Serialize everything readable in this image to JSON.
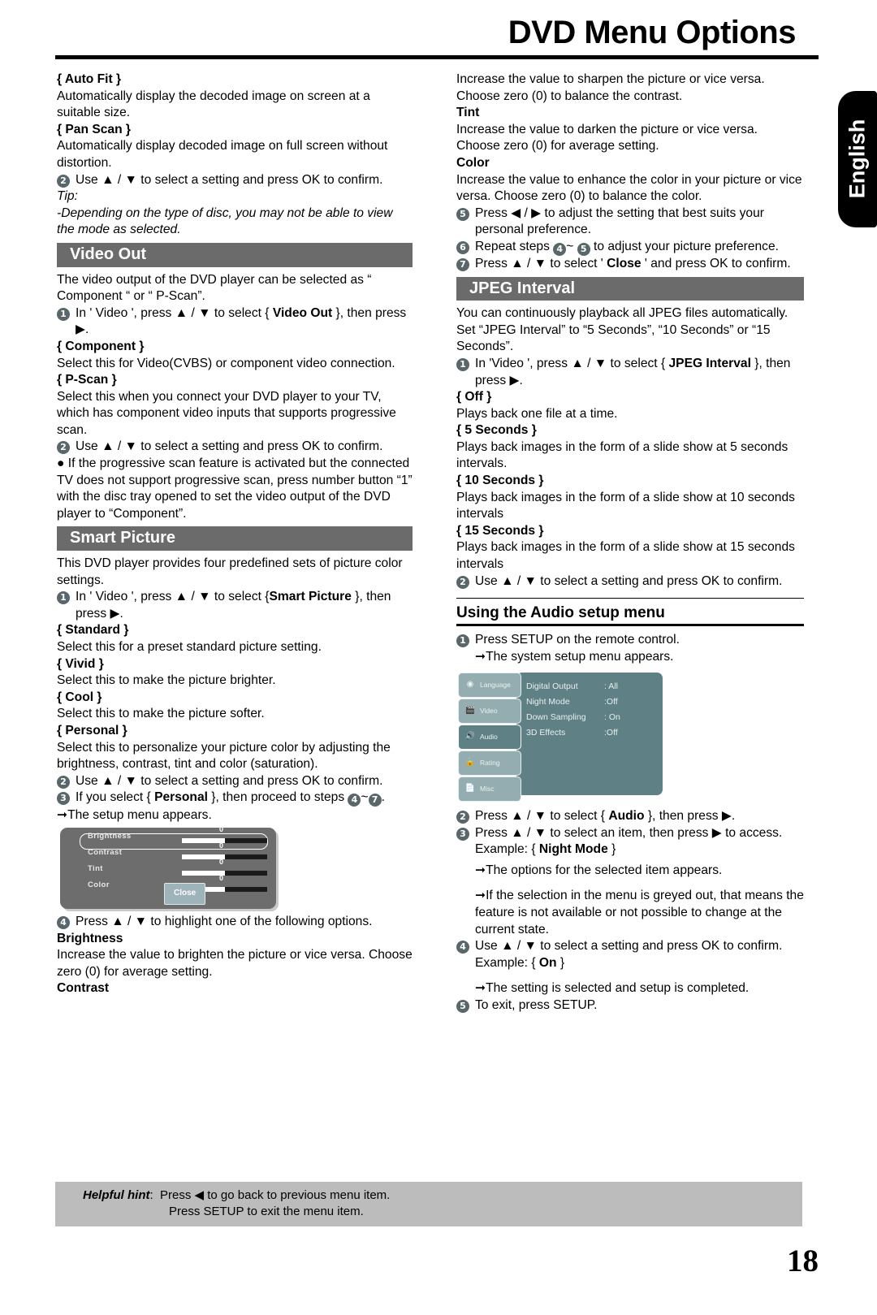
{
  "page": {
    "title": "DVD Menu Options",
    "number": "18",
    "language_tab": "English"
  },
  "left_column": {
    "auto_fit": {
      "heading": "{ Auto Fit }",
      "body": "Automatically display the decoded image on screen at a suitable size."
    },
    "pan_scan": {
      "heading": "{ Pan Scan }",
      "body": "Automatically display decoded image on full screen without distortion."
    },
    "step_select_confirm": {
      "num": "2",
      "text": "Use ▲ / ▼ to select a setting and press OK to confirm."
    },
    "tip": {
      "label": "Tip:",
      "text": "-Depending on the type of disc, you may not be able to view the mode as selected."
    },
    "video_out": {
      "section_title": "Video Out",
      "intro": "The video output of the DVD player can be selected as “ Component “ or “ P-Scan”.",
      "step1": {
        "num": "1",
        "text_a": "In ʹ Video ʹ, press ▲ / ▼   to select  { ",
        "bold": "Video Out",
        "text_b": " }, then press ▶."
      },
      "component": {
        "heading": "{ Component }",
        "body": "Select this for Video(CVBS) or component video connection."
      },
      "pscan": {
        "heading": "{ P-Scan }",
        "body": "Select this when you connect your DVD player to your TV, which has component video inputs that supports progressive scan."
      },
      "step2": {
        "num": "2",
        "text": "Use ▲ / ▼ to select a setting and press OK to confirm."
      },
      "bullet": "● If the progressive scan feature is activated but the connected TV does not support progressive scan, press number button “1” with the disc tray opened to set the video output of the DVD player to “Component”."
    },
    "smart_picture": {
      "section_title": "Smart Picture",
      "intro": "This DVD player provides four predefined sets of picture color settings.",
      "step1": {
        "num": "1",
        "text_a": "In ʹ Video ʹ, press ▲ / ▼ to select {",
        "bold": "Smart Picture",
        "text_b": " }, then press ▶."
      },
      "standard": {
        "heading": "{ Standard }",
        "body": "Select this for a preset standard picture setting."
      },
      "vivid": {
        "heading": "{ Vivid }",
        "body": "Select this to make the picture brighter."
      },
      "cool": {
        "heading": "{ Cool }",
        "body": "Select this to make the picture softer."
      },
      "personal": {
        "heading": "{ Personal }",
        "body": "Select this to personalize your picture color by adjusting the brightness, contrast, tint and color (saturation)."
      },
      "step2": {
        "num": "2",
        "text": "Use ▲ / ▼ to select a setting and press OK to confirm."
      },
      "step3": {
        "num": "3",
        "text_a": "If you select { ",
        "bold": "Personal",
        "text_b": " }, then proceed to steps ",
        "from": "4",
        "tilde": "~",
        "to": "7",
        "tail": "."
      },
      "setup_appears": "The setup menu appears.",
      "step4": {
        "num": "4",
        "text": "Press ▲ / ▼ to highlight one of the following options."
      },
      "brightness": {
        "heading": "Brightness",
        "body": "Increase the value to brighten the picture or vice versa. Choose zero (0) for average setting."
      },
      "contrast_heading": "Contrast"
    },
    "picture_menu": {
      "rows": [
        {
          "label": "Brightness",
          "value": "0",
          "fill_percent": 50,
          "highlighted": true
        },
        {
          "label": "Contrast",
          "value": "0",
          "fill_percent": 50,
          "highlighted": false
        },
        {
          "label": "Tint",
          "value": "0",
          "fill_percent": 50,
          "highlighted": false
        },
        {
          "label": "Color",
          "value": "0",
          "fill_percent": 50,
          "highlighted": false
        }
      ],
      "close_label": "Close"
    }
  },
  "right_column": {
    "contrast_body": "Increase the value to sharpen the picture or vice versa.  Choose zero (0) to balance the contrast.",
    "tint": {
      "heading": "Tint",
      "body": "Increase the value to darken the picture or vice versa.  Choose zero (0) for average setting."
    },
    "color": {
      "heading": "Color",
      "body": "Increase the value to enhance the color in your picture or vice versa. Choose zero (0) to balance the color."
    },
    "step5": {
      "num": "5",
      "text": "Press ◀ / ▶ to adjust the setting that best suits your personal preference."
    },
    "step6": {
      "num": "6",
      "text_a": "Repeat steps ",
      "from": "4",
      "tilde": "~ ",
      "to": "5",
      "text_b": " to adjust your picture preference."
    },
    "step7": {
      "num": "7",
      "text_a": "Press ▲ / ▼ to select  ʹ ",
      "bold": "Close",
      "text_b": " ʹ  and press OK to confirm."
    },
    "jpeg_interval": {
      "section_title": "JPEG Interval",
      "intro": "You can continuously playback all JPEG files automatically. Set “JPEG Interval” to “5 Seconds”, “10 Seconds” or “15 Seconds”.",
      "step1": {
        "num": "1",
        "text_a": "In ʹVideo ʹ, press ▲ / ▼ to select  { ",
        "bold": "JPEG Interval",
        "text_b": " }, then press ▶."
      },
      "off": {
        "heading": "{ Off }",
        "body": "Plays back one file at a time."
      },
      "s5": {
        "heading": "{ 5 Seconds }",
        "body": "Plays back images in the form of a slide show at 5 seconds intervals."
      },
      "s10": {
        "heading": "{ 10 Seconds }",
        "body": "Plays back images in the form of a slide show at 10 seconds intervals"
      },
      "s15": {
        "heading": "{ 15 Seconds }",
        "body": "Plays back images in the form of a slide show at 15 seconds intervals"
      },
      "step2": {
        "num": "2",
        "text": "Use ▲ / ▼ to select a setting and press OK to confirm."
      }
    },
    "audio_setup": {
      "section_title": "Using the Audio setup menu",
      "step1": {
        "num": "1",
        "text": "Press SETUP on the remote control."
      },
      "step1_arrow": "The system setup menu appears.",
      "step2": {
        "num": "2",
        "text_a": "Press ▲ / ▼ to select { ",
        "bold": "Audio",
        "text_b": " }, then press ▶."
      },
      "step3": {
        "num": "3",
        "text": "Press ▲ / ▼ to select an item, then press ▶ to access."
      },
      "example_night_mode_a": "Example: { ",
      "example_night_mode_b": "Night Mode",
      "example_night_mode_c": " }",
      "arrow_options": "The options for the selected item appears.",
      "arrow_greyed": "If the selection in the menu is greyed out, that means the feature is not available or not possible to change at the current state.",
      "step4": {
        "num": "4",
        "text": "Use ▲ / ▼ to select a setting and press OK to confirm."
      },
      "example_on_a": "Example: { ",
      "example_on_b": "On",
      "example_on_c": " }",
      "arrow_completed": "The setting is selected and setup is completed.",
      "step5": {
        "num": "5",
        "text": "To exit, press SETUP."
      }
    },
    "system_menu": {
      "tabs": [
        {
          "label": "Language",
          "icon": "globe-icon",
          "active": false
        },
        {
          "label": "Video",
          "icon": "film-icon",
          "active": false
        },
        {
          "label": "Audio",
          "icon": "speaker-icon",
          "active": true
        },
        {
          "label": "Rating",
          "icon": "lock-icon",
          "active": false
        },
        {
          "label": "Misc",
          "icon": "document-icon",
          "active": false
        }
      ],
      "items": [
        {
          "label": "Digital Output",
          "value": ": All"
        },
        {
          "label": "Night  Mode",
          "value": ":Off"
        },
        {
          "label": "Down Sampling",
          "value": ": On"
        },
        {
          "label": "3D Effects",
          "value": ":Off"
        }
      ]
    }
  },
  "footer": {
    "hint_label": "Helpful hint",
    "hint_sep": ":",
    "hint_line1": "Press ◀ to go back to previous menu item.",
    "hint_line2": "Press SETUP to exit the menu item."
  },
  "colors": {
    "section_bar": "#6b6b6b",
    "step_badge": "#59676b",
    "hint_band": "#bcbcbc",
    "menu_teal": "#5f8085",
    "menu_grey": "#6d6d6d"
  }
}
